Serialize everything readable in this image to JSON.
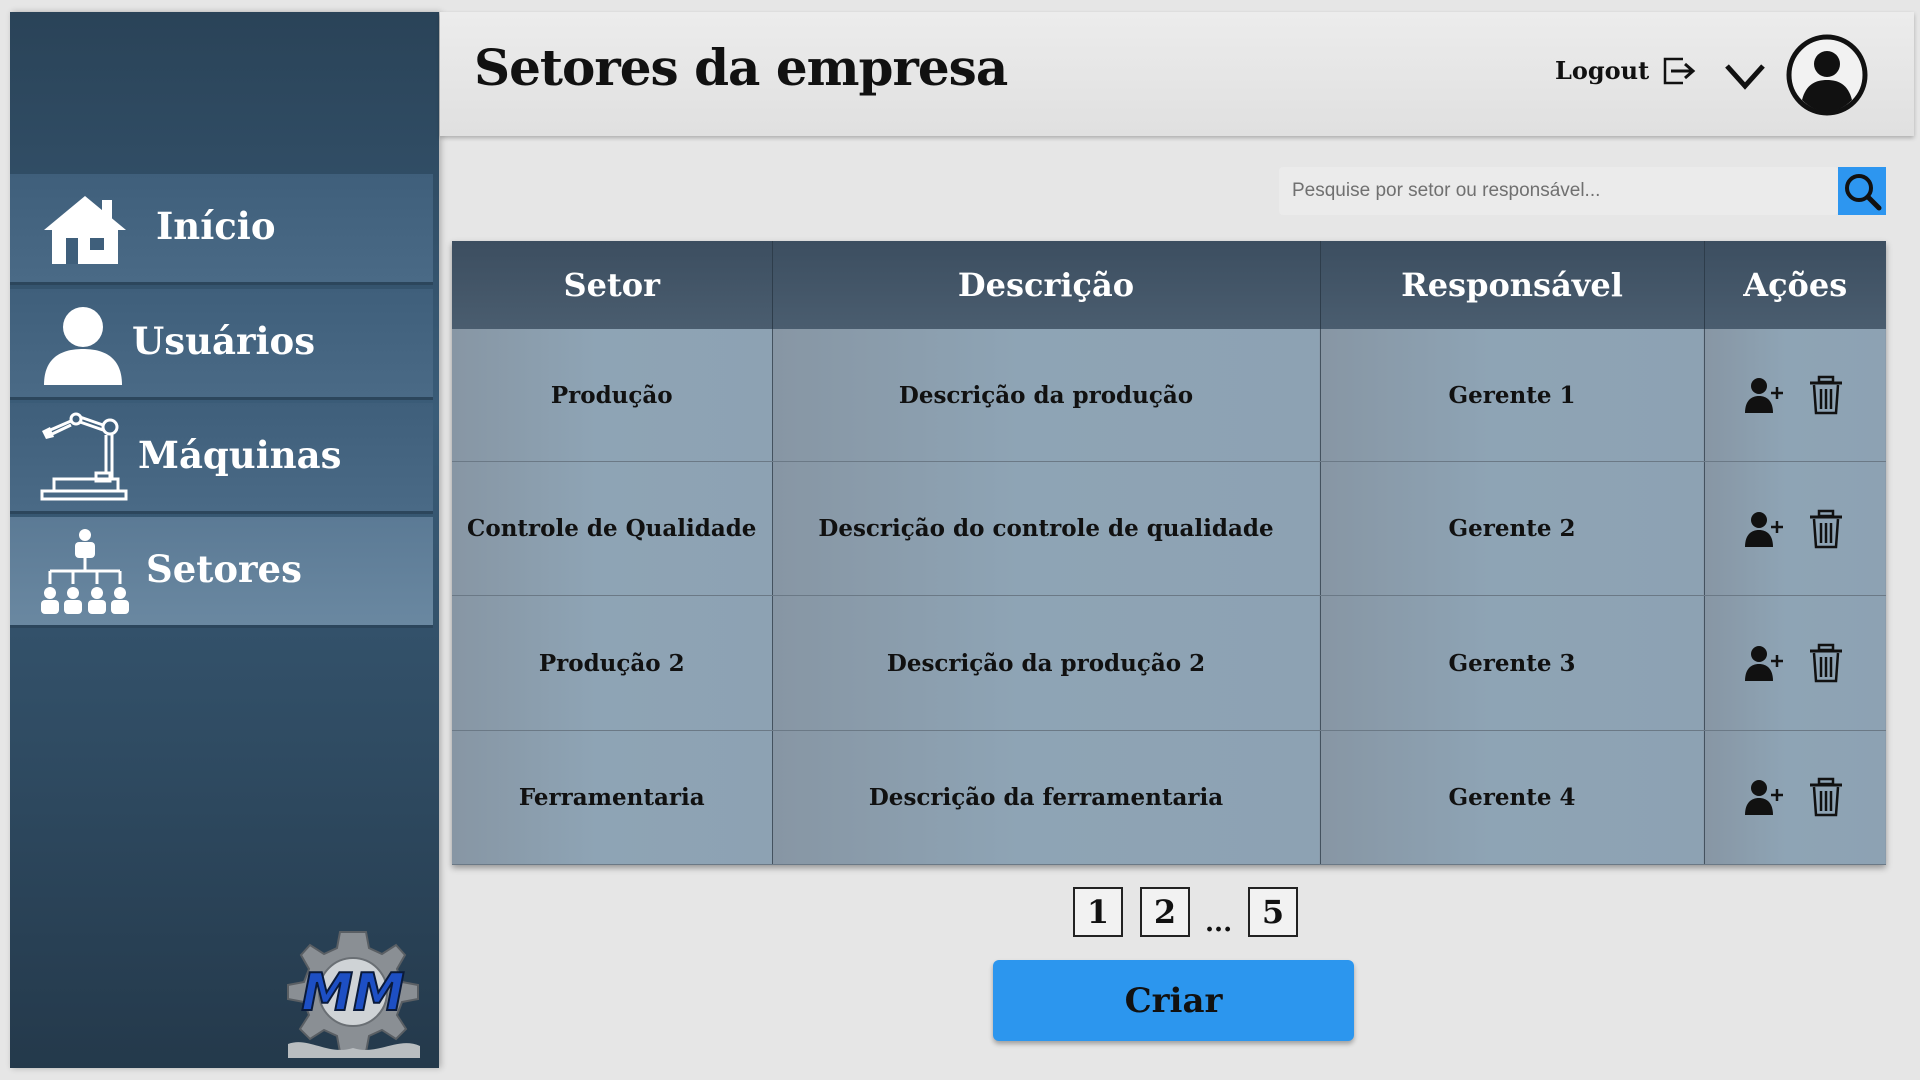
{
  "sidebar": {
    "items": [
      {
        "label": "Início",
        "icon": "home-icon"
      },
      {
        "label": "Usuários",
        "icon": "user-icon"
      },
      {
        "label": "Máquinas",
        "icon": "robot-arm-icon"
      },
      {
        "label": "Setores",
        "icon": "org-chart-icon",
        "active": true
      }
    ],
    "logo_text": "MM"
  },
  "header": {
    "title": "Setores da empresa",
    "logout_label": "Logout"
  },
  "search": {
    "placeholder": "Pesquise por setor ou responsável..."
  },
  "table": {
    "columns": [
      "Setor",
      "Descrição",
      "Responsável",
      "Ações"
    ],
    "rows": [
      {
        "setor": "Produção",
        "descricao": "Descrição da produção",
        "responsavel": "Gerente 1"
      },
      {
        "setor": "Controle de Qualidade",
        "descricao": "Descrição do controle de qualidade",
        "responsavel": "Gerente 2"
      },
      {
        "setor": "Produção 2",
        "descricao": "Descrição da produção 2",
        "responsavel": "Gerente 3"
      },
      {
        "setor": "Ferramentaria",
        "descricao": "Descrição da ferramentaria",
        "responsavel": "Gerente 4"
      }
    ]
  },
  "pagination": {
    "pages": [
      "1",
      "2",
      "5"
    ],
    "ellipsis": "..."
  },
  "create_label": "Criar",
  "colors": {
    "accent": "#2c96ee",
    "sidebar": "#3a5c78",
    "header_row": "#3c4e60"
  }
}
